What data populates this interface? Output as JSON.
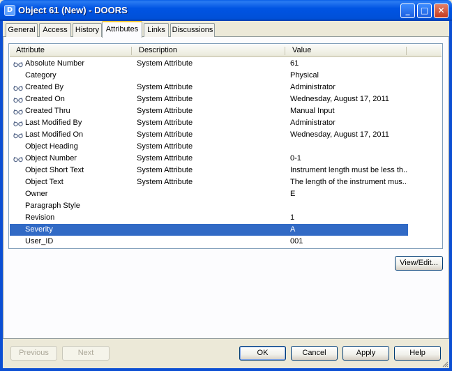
{
  "window": {
    "title": "Object 61 (New) - DOORS",
    "minimize_label": "_",
    "maximize_label": "□",
    "close_label": "✕"
  },
  "tabs": [
    {
      "label": "General"
    },
    {
      "label": "Access"
    },
    {
      "label": "History"
    },
    {
      "label": "Attributes",
      "active": true
    },
    {
      "label": "Links"
    },
    {
      "label": "Discussions"
    }
  ],
  "attributes_table": {
    "columns": [
      "Attribute",
      "Description",
      "Value"
    ],
    "rows": [
      {
        "attribute": "Absolute Number",
        "description": "System Attribute",
        "value": "61",
        "icon": "glasses-icon"
      },
      {
        "attribute": "Category",
        "description": "",
        "value": "Physical"
      },
      {
        "attribute": "Created By",
        "description": "System Attribute",
        "value": "Administrator",
        "icon": "glasses-icon"
      },
      {
        "attribute": "Created On",
        "description": "System Attribute",
        "value": "Wednesday, August 17, 2011",
        "icon": "glasses-icon"
      },
      {
        "attribute": "Created Thru",
        "description": "System Attribute",
        "value": "Manual Input",
        "icon": "glasses-icon"
      },
      {
        "attribute": "Last Modified By",
        "description": "System Attribute",
        "value": "Administrator",
        "icon": "glasses-icon"
      },
      {
        "attribute": "Last Modified On",
        "description": "System Attribute",
        "value": "Wednesday, August 17, 2011",
        "icon": "glasses-icon"
      },
      {
        "attribute": "Object Heading",
        "description": "System Attribute",
        "value": ""
      },
      {
        "attribute": "Object Number",
        "description": "System Attribute",
        "value": "0-1",
        "icon": "glasses-icon"
      },
      {
        "attribute": "Object Short Text",
        "description": "System Attribute",
        "value": "Instrument length must be less th..."
      },
      {
        "attribute": "Object Text",
        "description": "System Attribute",
        "value": "The length of the instrument mus..."
      },
      {
        "attribute": "Owner",
        "description": "",
        "value": "E"
      },
      {
        "attribute": "Paragraph Style",
        "description": "",
        "value": ""
      },
      {
        "attribute": "Revision",
        "description": "",
        "value": "1"
      },
      {
        "attribute": "Severity",
        "description": "",
        "value": "A",
        "selected": true
      },
      {
        "attribute": "User_ID",
        "description": "",
        "value": "001"
      }
    ]
  },
  "buttons": {
    "view_edit": "View/Edit...",
    "previous": "Previous",
    "next": "Next",
    "ok": "OK",
    "cancel": "Cancel",
    "apply": "Apply",
    "help": "Help"
  },
  "colors": {
    "selection": "#316ac5",
    "titlebar": "#0054e3",
    "dialog_bg": "#ece9d8"
  }
}
